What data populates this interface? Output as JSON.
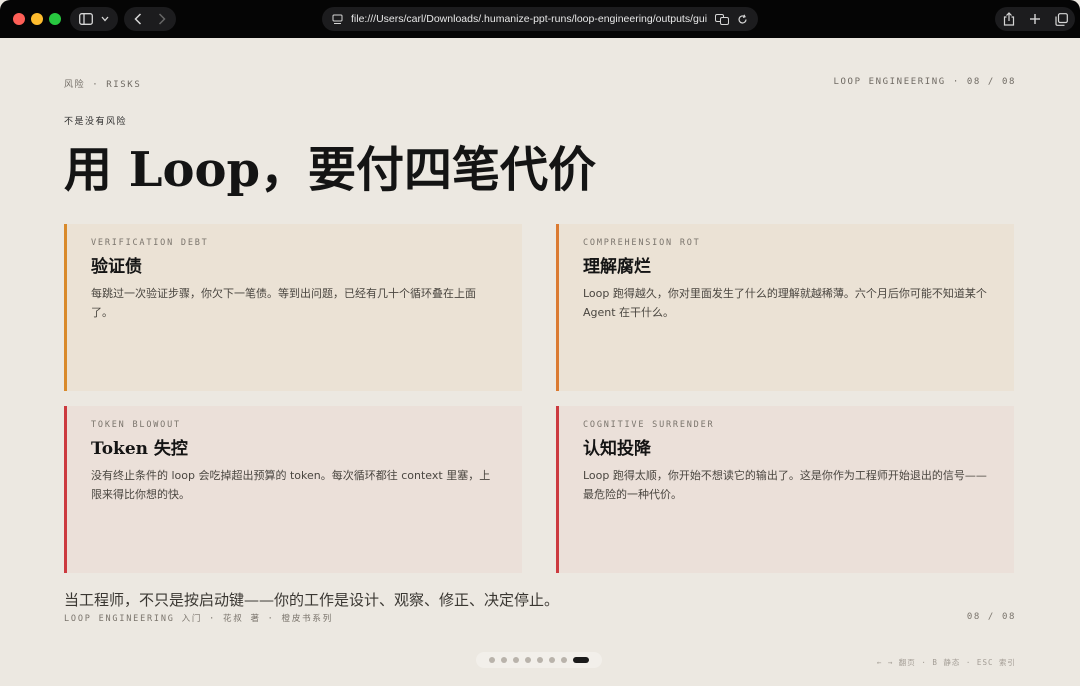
{
  "browser": {
    "url": "file:///Users/carl/Downloads/.humanize-ppt-runs/loop-engineering/outputs/guizang"
  },
  "header": {
    "section": "风险 · RISKS",
    "deck_label": "LOOP ENGINEERING · 08 / 08"
  },
  "slide": {
    "kicker": "不是没有风险",
    "title": "用 Loop，要付四笔代价"
  },
  "cards": [
    {
      "label": "VERIFICATION DEBT",
      "title": "验证债",
      "body": "每跳过一次验证步骤，你欠下一笔债。等到出问题，已经有几十个循环叠在上面了。"
    },
    {
      "label": "COMPREHENSION ROT",
      "title": "理解腐烂",
      "body": "Loop 跑得越久，你对里面发生了什么的理解就越稀薄。六个月后你可能不知道某个 Agent 在干什么。"
    },
    {
      "label": "TOKEN BLOWOUT",
      "title": "Token 失控",
      "body": "没有终止条件的 loop 会吃掉超出预算的 token。每次循环都往 context 里塞，上限来得比你想的快。"
    },
    {
      "label": "COGNITIVE SURRENDER",
      "title": "认知投降",
      "body": "Loop 跑得太顺，你开始不想读它的输出了。这是你作为工程师开始退出的信号——最危险的一种代价。"
    }
  ],
  "footer": {
    "quote": "当工程师，不只是按启动键——你的工作是设计、观察、修正、决定停止。",
    "colophon": "LOOP ENGINEERING 入门 · 花叔 著 · 橙皮书系列",
    "page": "08 / 08",
    "keys_hint": "← → 翻页 · B 静态 · ESC 索引"
  },
  "pagination": {
    "total": 8,
    "current": 8
  },
  "colors": {
    "background": "#ece8e1",
    "accent_amber": "#d98a2b",
    "accent_red": "#cc3a3f"
  }
}
